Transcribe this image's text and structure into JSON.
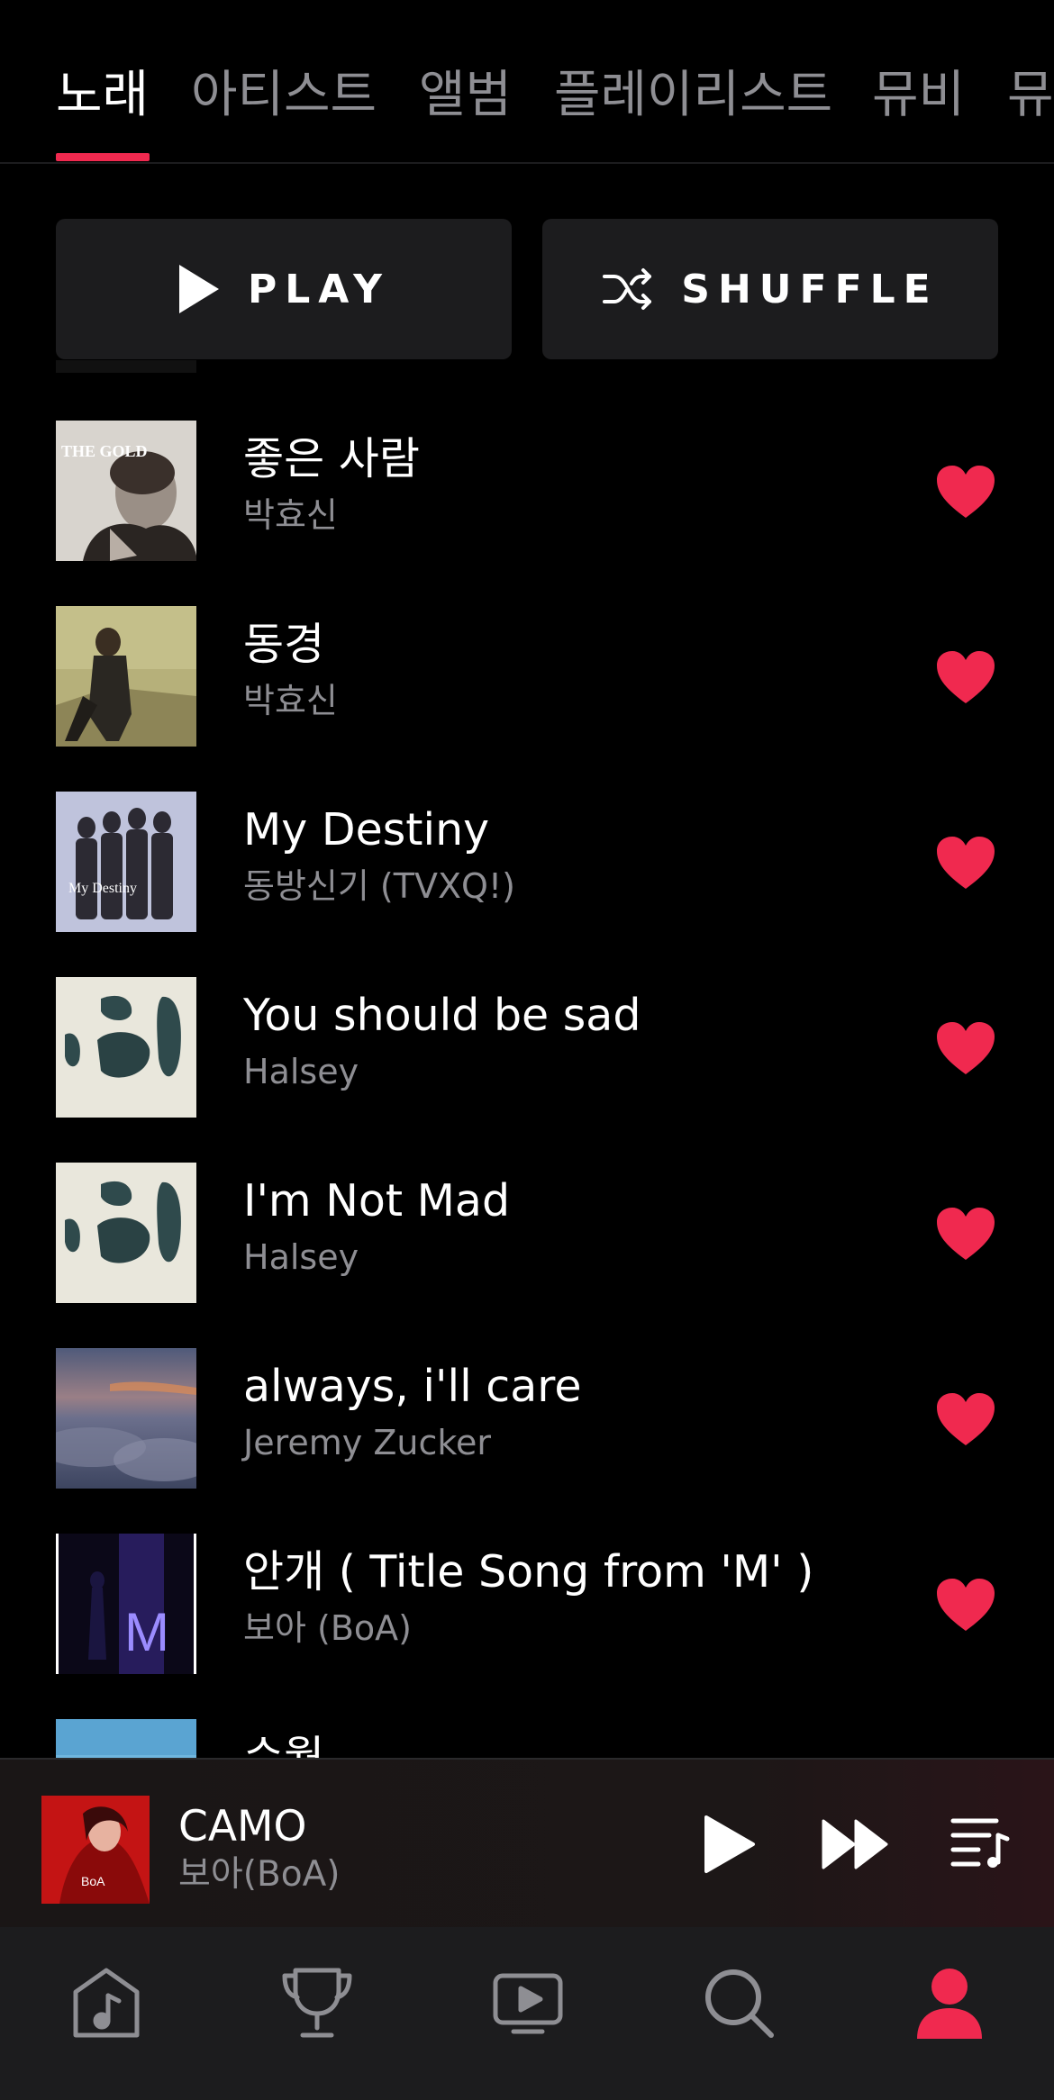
{
  "tabs": [
    {
      "label": "노래",
      "active": true
    },
    {
      "label": "아티스트",
      "active": false
    },
    {
      "label": "앨범",
      "active": false
    },
    {
      "label": "플레이리스트",
      "active": false
    },
    {
      "label": "뮤비",
      "active": false
    },
    {
      "label": "뮤",
      "active": false
    }
  ],
  "buttons": {
    "play_label": "PLAY",
    "shuffle_label": "SHUFFLE",
    "play_icon": "play-icon",
    "shuffle_icon": "shuffle-icon"
  },
  "songs": [
    {
      "title": "좋은 사람",
      "artist": "박효신",
      "liked": true,
      "art_text": "THE GOLD"
    },
    {
      "title": "동경",
      "artist": "박효신",
      "liked": true
    },
    {
      "title": "My Destiny",
      "artist": "동방신기 (TVXQ!)",
      "liked": true,
      "art_text": "My Destiny"
    },
    {
      "title": "You should be sad",
      "artist": "Halsey",
      "liked": true
    },
    {
      "title": "I'm Not Mad",
      "artist": "Halsey",
      "liked": true
    },
    {
      "title": "always, i'll care",
      "artist": "Jeremy Zucker",
      "liked": true
    },
    {
      "title": "안개 ( Title Song from 'M' )",
      "artist": "보아 (BoA)",
      "liked": true,
      "art_text": "M"
    },
    {
      "title": "수월",
      "artist": "",
      "liked": false
    }
  ],
  "now_playing": {
    "title": "CAMO",
    "artist": "보아(BoA)",
    "art_text": "BoA"
  },
  "nav": [
    {
      "name": "music-note-icon",
      "active": false
    },
    {
      "name": "trophy-icon",
      "active": false
    },
    {
      "name": "video-play-icon",
      "active": false
    },
    {
      "name": "search-icon",
      "active": false
    },
    {
      "name": "profile-icon",
      "active": true
    }
  ],
  "colors": {
    "accent": "#f0294f",
    "background": "#000000",
    "surface": "#1c1c1e",
    "secondary_text": "#8e8e93"
  }
}
